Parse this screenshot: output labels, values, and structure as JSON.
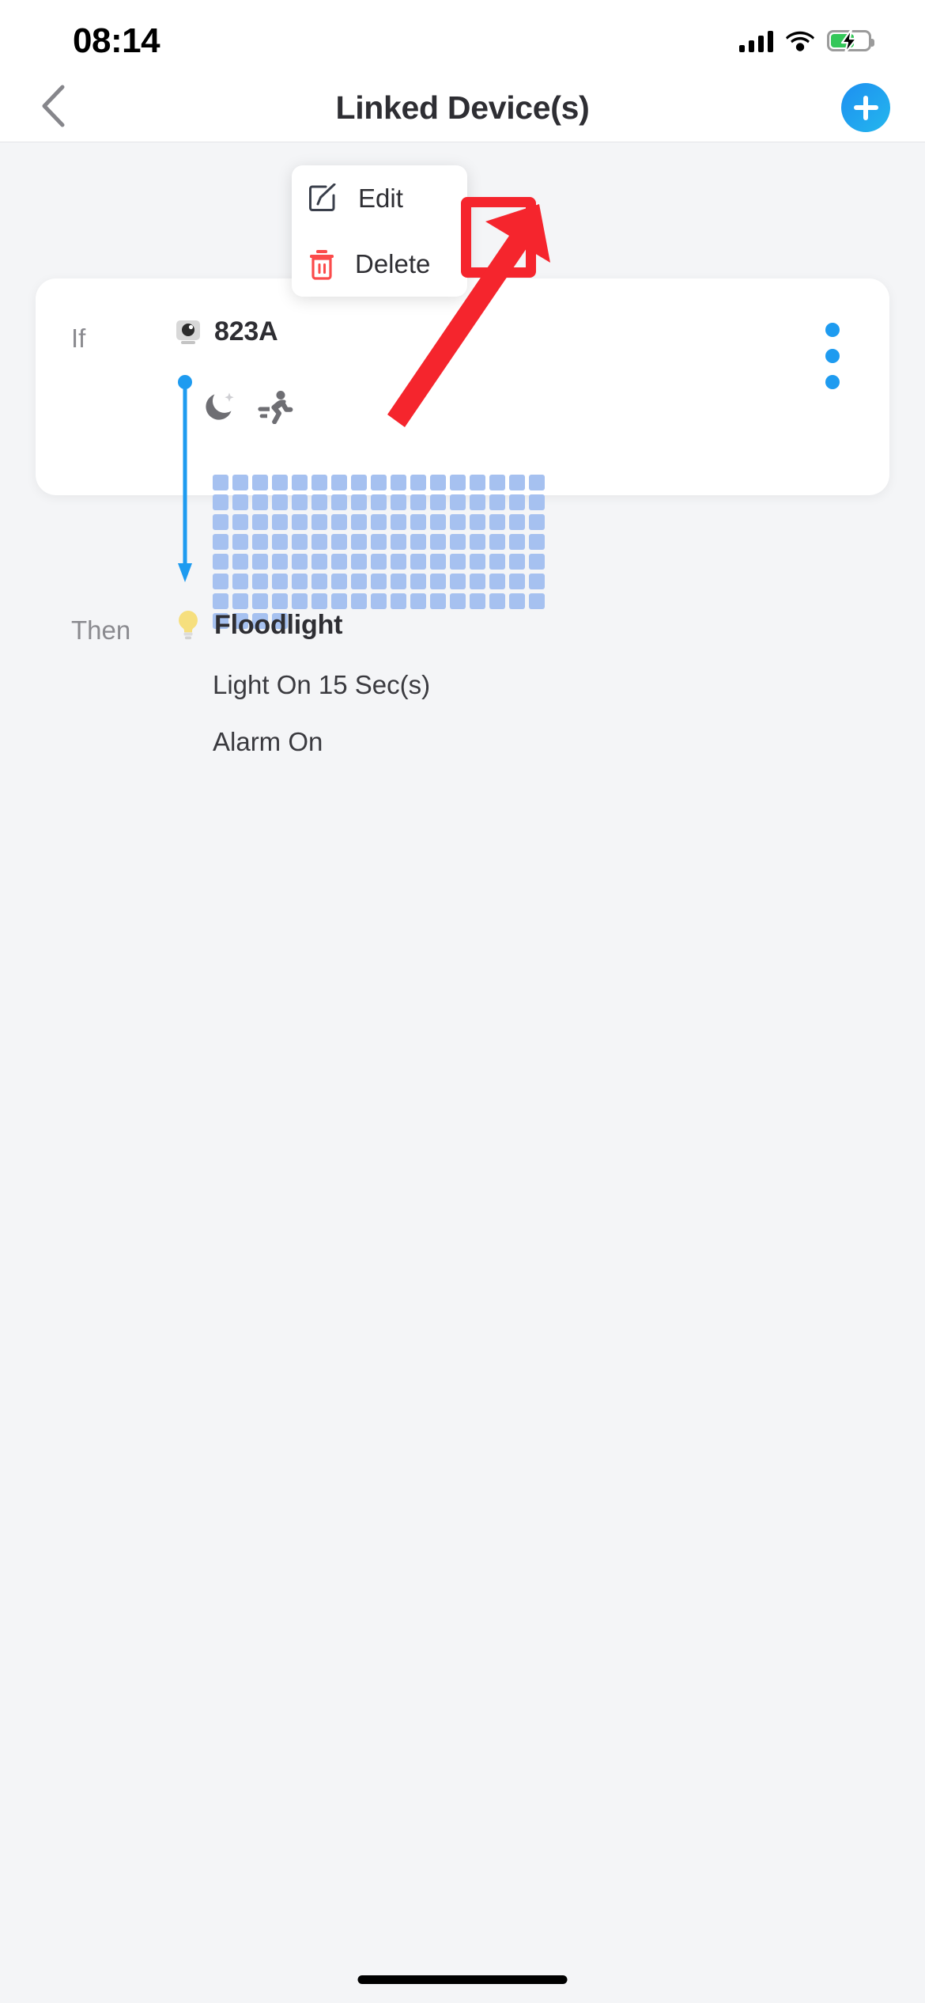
{
  "status_bar": {
    "time": "08:14",
    "cellular_icon": "cellular-bars-icon",
    "wifi_icon": "wifi-icon",
    "battery_icon": "battery-charging-icon",
    "battery_level_percent": 62,
    "battery_charging": true
  },
  "nav_bar": {
    "back_icon": "chevron-left-icon",
    "title": "Linked Device(s)",
    "add_icon": "plus-icon",
    "add_button_color": "#1d8ff0"
  },
  "rule_card": {
    "if_label": "If",
    "then_label": "Then",
    "trigger": {
      "device_icon": "camera-icon",
      "device_name": "823A",
      "conditions": [
        {
          "icon": "moon-icon",
          "name": "night-mode"
        },
        {
          "icon": "motion-running-icon",
          "name": "motion-detection"
        }
      ],
      "schedule_grid": {
        "rows": 7,
        "columns": 18,
        "active_color": "#a6c1f0",
        "total_cells": 123
      }
    },
    "action": {
      "device_icon": "lightbulb-icon",
      "device_name": "Floodlight",
      "lines": [
        "Light On 15 Sec(s)",
        "Alarm On"
      ]
    },
    "overflow_icon": "kebab-menu-icon",
    "overflow_color": "#1e9bf0",
    "connector_color": "#1e9bf0"
  },
  "context_menu": {
    "items": [
      {
        "icon": "edit-pencil-square-icon",
        "label": "Edit",
        "color": "#3a3f4b"
      },
      {
        "icon": "trash-delete-icon",
        "label": "Delete",
        "color": "#fb4b4b"
      }
    ]
  },
  "annotation": {
    "highlight_color": "#f5252d",
    "arrow_icon": "pointer-arrow-icon",
    "target": "kebab-menu-icon"
  },
  "home_indicator": {
    "name": "home-indicator"
  }
}
